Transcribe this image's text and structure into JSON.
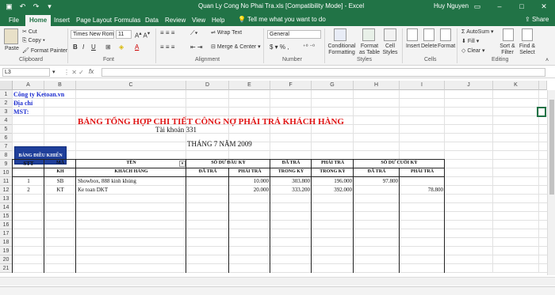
{
  "window": {
    "title": "Quan Ly Cong No Phai Tra.xls  [Compatibility Mode]  -  Excel",
    "user": "Huy Nguyen"
  },
  "tabs": [
    "File",
    "Home",
    "Insert",
    "Page Layout",
    "Formulas",
    "Data",
    "Review",
    "View",
    "Help"
  ],
  "tell_me": "Tell me what you want to do",
  "share": "Share",
  "ribbon": {
    "paste": "Paste",
    "cut": "Cut",
    "copy": "Copy",
    "format_painter": "Format Painter",
    "clipboard": "Clipboard",
    "font_name": "Times New Roma",
    "font_size": "11",
    "font": "Font",
    "wrap_text": "Wrap Text",
    "merge_center": "Merge & Center",
    "alignment": "Alignment",
    "number_format": "General",
    "number": "Number",
    "conditional_formatting": "Conditional Formatting",
    "format_as_table": "Format as Table",
    "cell_styles": "Cell Styles",
    "styles": "Styles",
    "insert": "Insert",
    "delete": "Delete",
    "format": "Format",
    "cells": "Cells",
    "autosum": "AutoSum",
    "fill": "Fill",
    "clear": "Clear",
    "sort_filter": "Sort & Filter",
    "find_select": "Find & Select",
    "editing": "Editing"
  },
  "formula_bar": {
    "name_box": "L3",
    "fx": "fx",
    "value": ""
  },
  "columns": [
    "A",
    "B",
    "C",
    "D",
    "E",
    "F",
    "G",
    "H",
    "I",
    "J",
    "K"
  ],
  "rows": [
    "1",
    "2",
    "3",
    "4",
    "5",
    "6",
    "7",
    "8",
    "9",
    "10",
    "11",
    "12",
    "13",
    "14",
    "15",
    "16",
    "17",
    "18",
    "19",
    "20",
    "21"
  ],
  "sheet": {
    "company": "Công ty  Ketoan.vn",
    "address": "Địa chỉ",
    "mst": "MST:",
    "report_title": "BẢNG TỔNG HỢP CHI TIẾT CÔNG NỢ PHẢI TRẢ KHÁCH HÀNG",
    "account": "Tài khoản  331",
    "month": "THÁNG 7 NĂM 2009",
    "nav_button": "BẢNG ĐIỀU KHIỂN",
    "headers": {
      "stt": "STT",
      "ma": "MÃ",
      "kh": "KH",
      "ten": "TÊN",
      "khach_hang": "KHÁCH HÀNG",
      "so_du_dau_ky": "SỐ DƯ ĐẦU KỲ",
      "da_tra": "ĐÃ TRẢ",
      "phai_tra": "PHẢI TRẢ",
      "trong_ky": "TRONG KỲ",
      "so_du_cuoi_ky": "SỐ DƯ CUỐI KỲ"
    },
    "data_rows": [
      {
        "stt": "1",
        "ma": "SB",
        "ten": "Showbox, 888 kinh khủng",
        "dau_da_tra": "",
        "dau_phai_tra": "10.000",
        "da_tra_trong_ky": "303.800",
        "phai_tra_trong_ky": "196.000",
        "cuoi_da_tra": "97.800",
        "cuoi_phai_tra": ""
      },
      {
        "stt": "2",
        "ma": "KT",
        "ten": "Ke toan DKT",
        "dau_da_tra": "",
        "dau_phai_tra": "20.000",
        "da_tra_trong_ky": "333.200",
        "phai_tra_trong_ky": "392.000",
        "cuoi_da_tra": "",
        "cuoi_phai_tra": "78.800"
      }
    ]
  }
}
